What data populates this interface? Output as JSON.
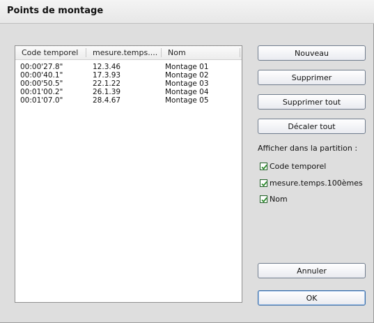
{
  "window": {
    "title": "Points de montage"
  },
  "list": {
    "columns": [
      "Code temporel",
      "mesure.temps....",
      "Nom"
    ],
    "rows": [
      {
        "timecode": "00:00'27.8\"",
        "mesure": "12.3.46",
        "nom": "Montage 01"
      },
      {
        "timecode": "00:00'40.1\"",
        "mesure": "17.3.93",
        "nom": "Montage 02"
      },
      {
        "timecode": "00:00'50.5\"",
        "mesure": "22.1.22",
        "nom": "Montage 03"
      },
      {
        "timecode": "00:01'00.2\"",
        "mesure": "26.1.39",
        "nom": "Montage 04"
      },
      {
        "timecode": "00:01'07.0\"",
        "mesure": "28.4.67",
        "nom": "Montage 05"
      }
    ]
  },
  "buttons": {
    "nouveau": "Nouveau",
    "supprimer": "Supprimer",
    "supprimer_tout": "Supprimer tout",
    "decaler_tout": "Décaler tout",
    "annuler": "Annuler",
    "ok": "OK"
  },
  "display": {
    "label": "Afficher dans la partition :",
    "options": [
      {
        "label": "Code temporel",
        "checked": true
      },
      {
        "label": "mesure.temps.100èmes",
        "checked": true
      },
      {
        "label": "Nom",
        "checked": true
      }
    ]
  },
  "colors": {
    "check": "#2e8b2e",
    "dialog_bg": "#dedede"
  }
}
